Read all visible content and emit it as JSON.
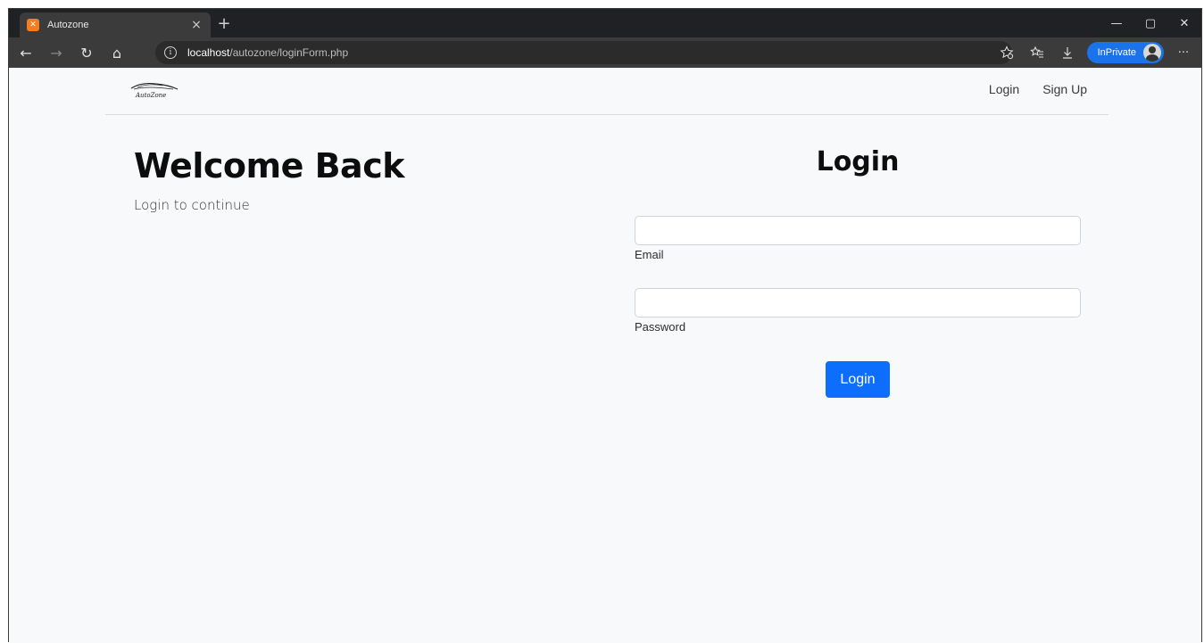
{
  "browser": {
    "tab_title": "Autozone",
    "tab_favicon": "xampp-icon",
    "tab_close": "×",
    "new_tab": "+",
    "window_controls": {
      "minimize": "—",
      "restore": "▢",
      "close": "✕"
    },
    "nav": {
      "back": "←",
      "forward": "→",
      "refresh": "↻",
      "home": "⌂"
    },
    "url_host": "localhost",
    "url_path": "/autozone/loginForm.php",
    "inprivate_label": "InPrivate",
    "more_menu": "···",
    "accent_color": "#1a73e8"
  },
  "navbar": {
    "brand_text": "AutoZone",
    "links": {
      "login": "Login",
      "signup": "Sign Up"
    }
  },
  "hero": {
    "title": "Welcome Back",
    "subtitle": "Login to continue"
  },
  "form": {
    "title": "Login",
    "email_label": "Email",
    "email_value": "",
    "password_label": "Password",
    "password_value": "",
    "submit_label": "Login",
    "submit_color": "#0d6efd"
  }
}
